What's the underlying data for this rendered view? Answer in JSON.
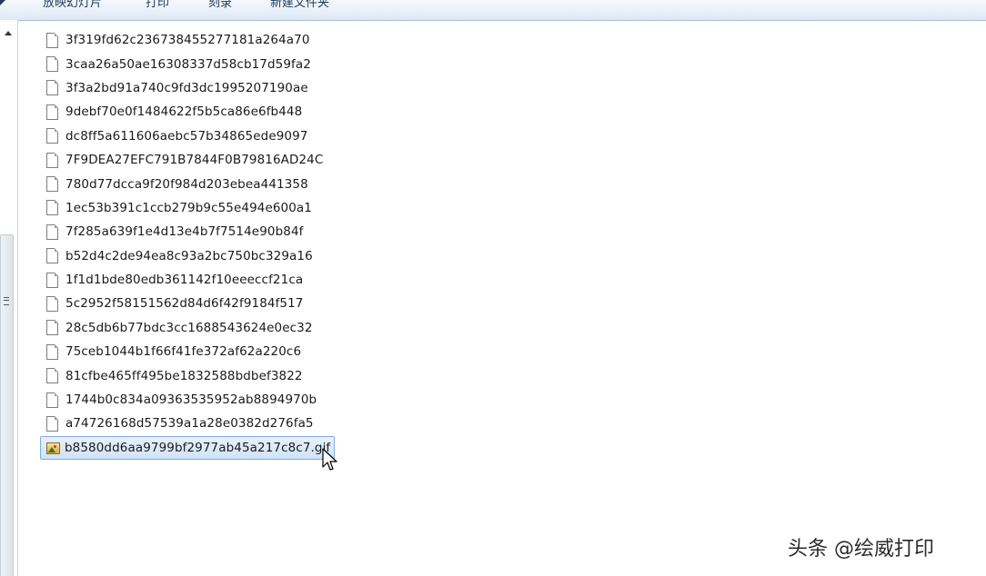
{
  "toolbar": {
    "buttons": [
      "放映幻灯片",
      "打印",
      "刻录",
      "新建文件夹"
    ]
  },
  "files": [
    {
      "name": "3f319fd62c236738455277181a264a70",
      "icon": "document-icon",
      "selected": false
    },
    {
      "name": "3caa26a50ae16308337d58cb17d59fa2",
      "icon": "document-icon",
      "selected": false
    },
    {
      "name": "3f3a2bd91a740c9fd3dc1995207190ae",
      "icon": "document-icon",
      "selected": false
    },
    {
      "name": "9debf70e0f1484622f5b5ca86e6fb448",
      "icon": "document-icon",
      "selected": false
    },
    {
      "name": "dc8ff5a611606aebc57b34865ede9097",
      "icon": "document-icon",
      "selected": false
    },
    {
      "name": "7F9DEA27EFC791B7844F0B79816AD24C",
      "icon": "document-icon",
      "selected": false
    },
    {
      "name": "780d77dcca9f20f984d203ebea441358",
      "icon": "document-icon",
      "selected": false
    },
    {
      "name": "1ec53b391c1ccb279b9c55e494e600a1",
      "icon": "document-icon",
      "selected": false
    },
    {
      "name": "7f285a639f1e4d13e4b7f7514e90b84f",
      "icon": "document-icon",
      "selected": false
    },
    {
      "name": "b52d4c2de94ea8c93a2bc750bc329a16",
      "icon": "document-icon",
      "selected": false
    },
    {
      "name": "1f1d1bde80edb361142f10eeeccf21ca",
      "icon": "document-icon",
      "selected": false
    },
    {
      "name": "5c2952f58151562d84d6f42f9184f517",
      "icon": "document-icon",
      "selected": false
    },
    {
      "name": "28c5db6b77bdc3cc1688543624e0ec32",
      "icon": "document-icon",
      "selected": false
    },
    {
      "name": "75ceb1044b1f66f41fe372af62a220c6",
      "icon": "document-icon",
      "selected": false
    },
    {
      "name": "81cfbe465ff495be1832588bdbef3822",
      "icon": "document-icon",
      "selected": false
    },
    {
      "name": "1744b0c834a09363535952ab8894970b",
      "icon": "document-icon",
      "selected": false
    },
    {
      "name": "a74726168d57539a1a28e0382d276fa5",
      "icon": "document-icon",
      "selected": false
    },
    {
      "name": "b8580dd6aa9799bf2977ab45a217c8c7.gif",
      "icon": "image-file-icon",
      "selected": true
    }
  ],
  "watermark": "头条 @绘威打印",
  "colors": {
    "selection_bg": "#cfe3f8",
    "selection_border": "#84acdd",
    "toolbar_bg": "#dfe9f5"
  }
}
